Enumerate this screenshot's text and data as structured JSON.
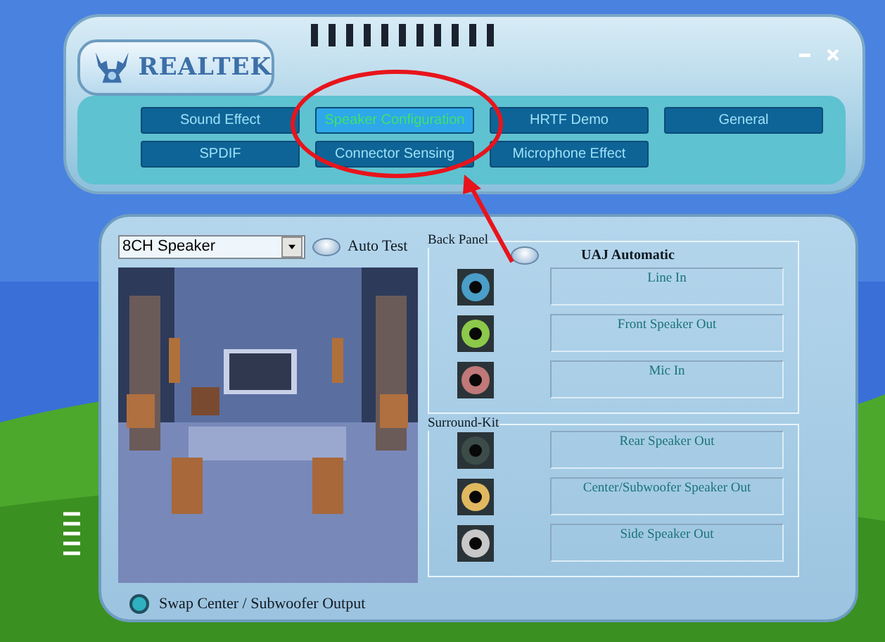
{
  "window": {
    "logo": "REALTEK"
  },
  "tabs": [
    {
      "label": "Sound Effect",
      "selected": false
    },
    {
      "label": "Speaker Configuration",
      "selected": true
    },
    {
      "label": "HRTF Demo",
      "selected": false
    },
    {
      "label": "General",
      "selected": false
    },
    {
      "label": "SPDIF",
      "selected": false
    },
    {
      "label": "Connector Sensing",
      "selected": false
    },
    {
      "label": "Microphone Effect",
      "selected": false
    }
  ],
  "speaker_config": {
    "dropdown": {
      "value": "8CH Speaker"
    },
    "auto_test": "Auto Test",
    "swap_option": {
      "label": "Swap Center / Subwoofer Output",
      "checked": true
    }
  },
  "back_panel": {
    "title": "Back Panel",
    "uaj": "UAJ Automatic",
    "jacks": [
      {
        "label": "Line In",
        "color": "#4a9ec8"
      },
      {
        "label": "Front Speaker Out",
        "color": "#8cc84a"
      },
      {
        "label": "Mic In",
        "color": "#c07878"
      }
    ]
  },
  "surround_kit": {
    "title": "Surround-Kit",
    "jacks": [
      {
        "label": "Rear Speaker Out",
        "color": "#3c4c48"
      },
      {
        "label": "Center/Subwoofer Speaker Out",
        "color": "#e0b860"
      },
      {
        "label": "Side Speaker Out",
        "color": "#c8c8c8"
      }
    ]
  }
}
